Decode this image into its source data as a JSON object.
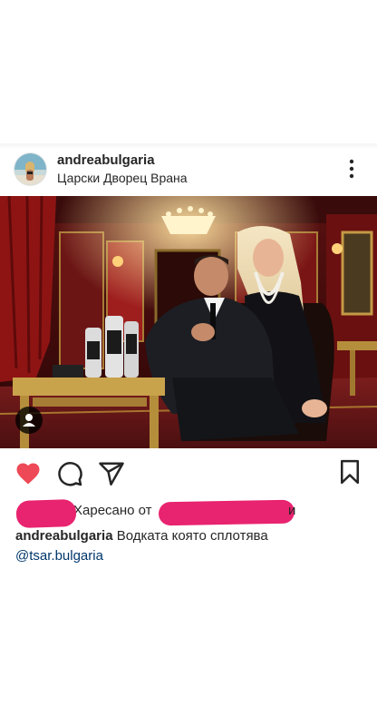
{
  "post": {
    "username": "andreabulgaria",
    "location": "Царски Дворец Врана",
    "likes_prefix": "Харесано от",
    "likes_suffix": "и",
    "caption_user": "andreabulgaria",
    "caption_text": "Водката която сплотява",
    "mention": "@tsar.bulgaria"
  },
  "icons": {
    "more": "more-vertical-icon",
    "tag": "user-tag-icon",
    "like": "heart-filled-icon",
    "comment": "comment-icon",
    "share": "send-icon",
    "save": "bookmark-icon"
  },
  "colors": {
    "like": "#ed4956",
    "mention": "#00376b",
    "redaction": "#e8236f"
  }
}
